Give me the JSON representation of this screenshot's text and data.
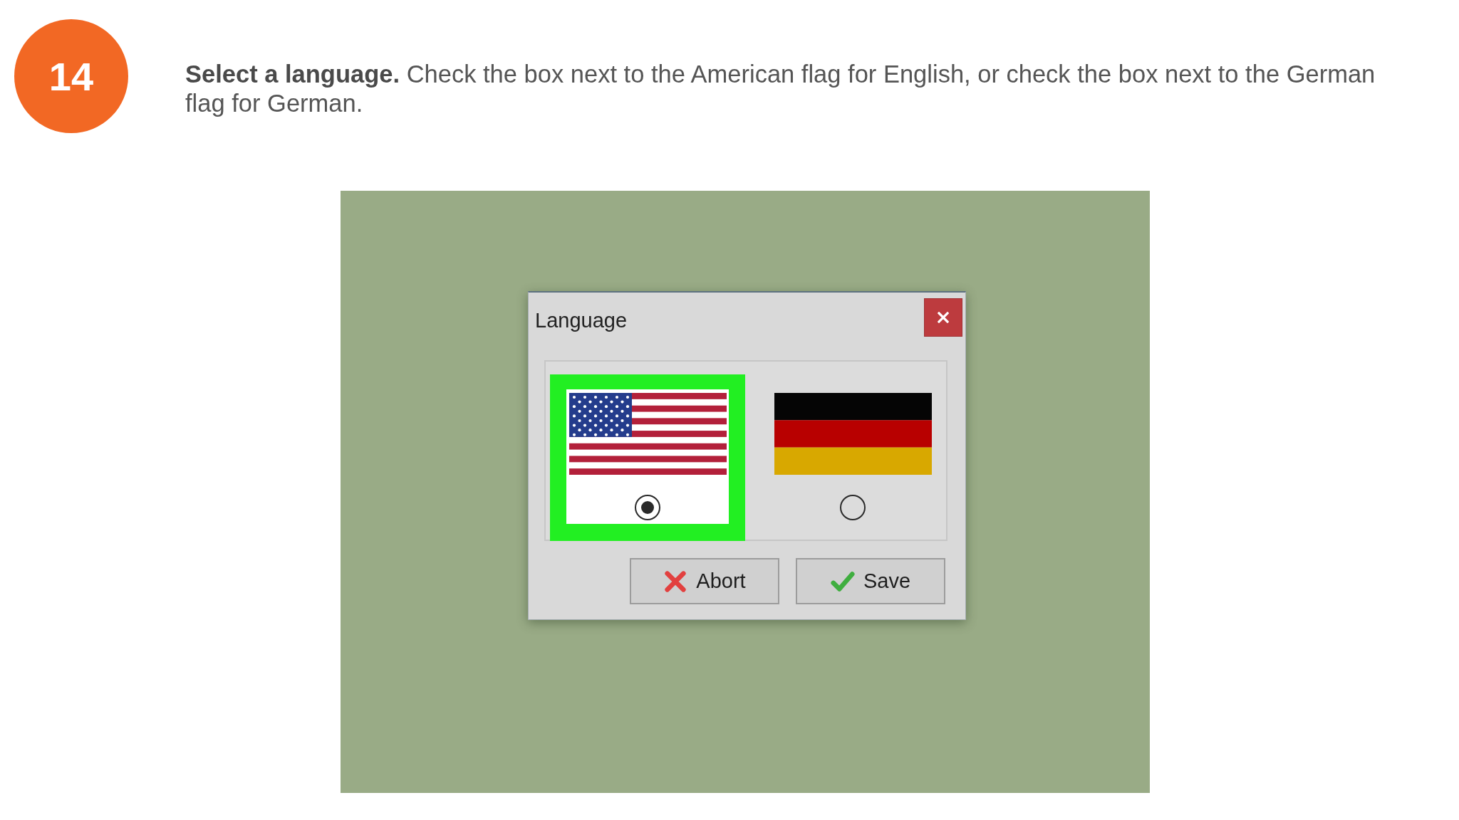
{
  "step": {
    "number": "14",
    "instruction": "**Select a language.** Check the box next to the American flag for English, or check the box next to the German flag for German."
  },
  "dialog": {
    "title": "Language",
    "languages": [
      {
        "kind": "us",
        "selected": true
      },
      {
        "kind": "de",
        "selected": false
      }
    ],
    "buttons": [
      {
        "kind": "abort",
        "label": "Abort"
      },
      {
        "kind": "save",
        "label": "Save"
      }
    ]
  }
}
